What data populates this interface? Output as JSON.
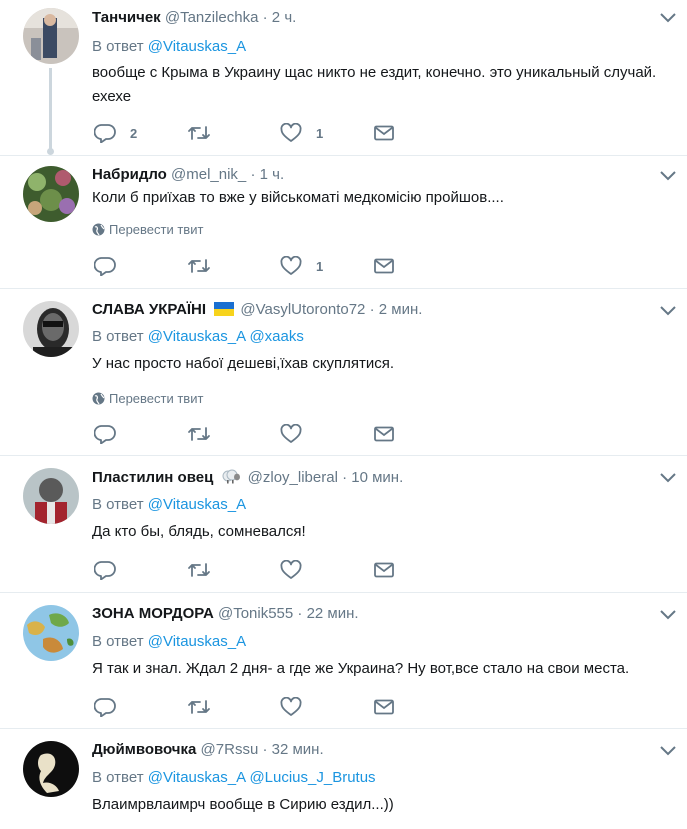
{
  "tweets": [
    {
      "name": "Танчичек",
      "handle": "@Tanzilechka",
      "time": "· 2 ч.",
      "reply_label": "В ответ",
      "mentions": [
        "@Vitauskas_A"
      ],
      "text": "вообще с Крыма в Украину щас никто не ездит, конечно. это уникальный случай. ехехе",
      "translate_label": "",
      "reply_count": "2",
      "like_count": "1"
    },
    {
      "name": "Набридло",
      "handle": "@mel_nik_",
      "time": "· 1 ч.",
      "reply_label": "",
      "mentions": [],
      "text": "Коли б приїхав то вже у військоматі медкомісію пройшов....",
      "translate_label": "Перевести твит",
      "reply_count": "",
      "like_count": "1"
    },
    {
      "name": "СЛАВА УКРАЇНІ",
      "handle": "@VasylUtoronto72",
      "time": "· 2 мин.",
      "reply_label": "В ответ",
      "mentions": [
        "@Vitauskas_A",
        "@xaaks"
      ],
      "text": "У нас просто набої дешеві,їхав скуплятися.",
      "translate_label": "Перевести твит",
      "reply_count": "",
      "like_count": ""
    },
    {
      "name": "Пластилин овец",
      "handle": "@zloy_liberal",
      "time": "· 10 мин.",
      "reply_label": "В ответ",
      "mentions": [
        "@Vitauskas_A"
      ],
      "text": "Да кто бы, блядь, сомневался!",
      "translate_label": "",
      "reply_count": "",
      "like_count": ""
    },
    {
      "name": "ЗОНА МОРДОРА",
      "handle": "@Tonik555",
      "time": "· 22 мин.",
      "reply_label": "В ответ",
      "mentions": [
        "@Vitauskas_A"
      ],
      "text": "Я так и знал. Ждал 2 дня- а где же Украина? Ну вот,все стало на свои места.",
      "translate_label": "",
      "reply_count": "",
      "like_count": ""
    },
    {
      "name": "Дюймвовочка",
      "handle": "@7Rssu",
      "time": "· 32 мин.",
      "reply_label": "В ответ",
      "mentions": [
        "@Vitauskas_A",
        "@Lucius_J_Brutus"
      ],
      "text": "Влаимрвлаимрч вообще в Сирию ездил...))",
      "translate_label": "",
      "reply_count": "",
      "like_count": ""
    }
  ],
  "colors": {
    "link": "#1b95e0",
    "secondary": "#657786",
    "divider": "#e6ecf0",
    "thread": "#ccd6dd"
  },
  "icons": {
    "reply": "reply-icon",
    "retweet": "retweet-icon",
    "like": "heart-icon",
    "dm": "envelope-icon",
    "caret": "chevron-down-icon",
    "globe": "globe-icon"
  }
}
